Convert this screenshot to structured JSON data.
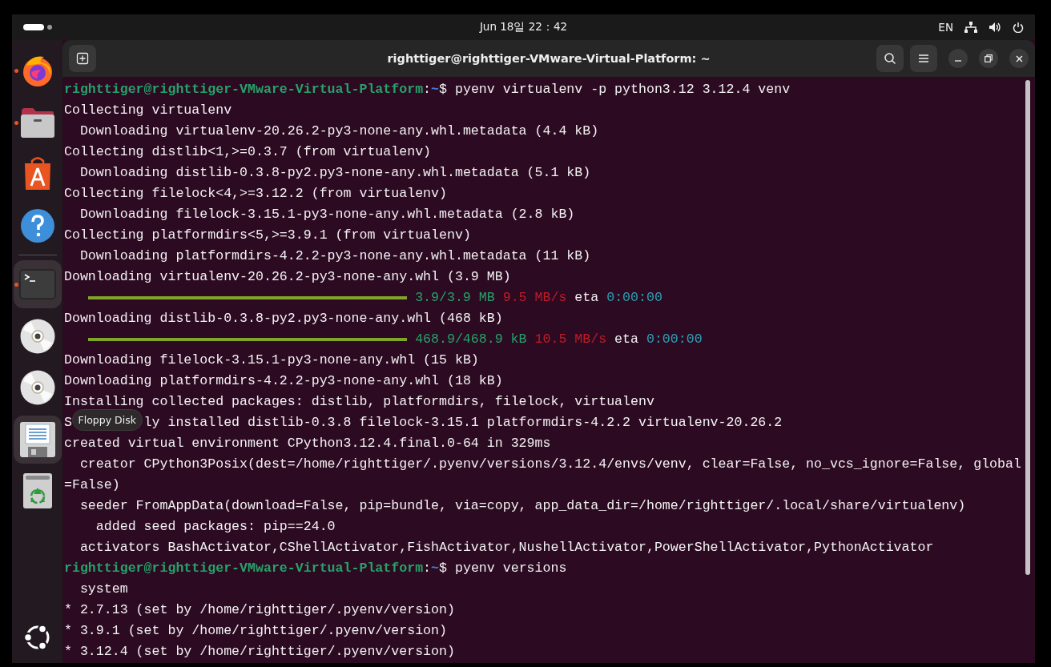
{
  "top_bar": {
    "clock": "Jun 18일 22：42",
    "input_language": "EN"
  },
  "dock": {
    "items": [
      {
        "kind": "firefox",
        "running": true,
        "highlighted": false
      },
      {
        "kind": "files",
        "running": true,
        "highlighted": false
      },
      {
        "kind": "app-center",
        "running": false,
        "highlighted": false
      },
      {
        "kind": "help",
        "running": false,
        "highlighted": false
      },
      {
        "kind": "separator"
      },
      {
        "kind": "terminal",
        "running": true,
        "highlighted": true
      },
      {
        "kind": "disc",
        "running": false,
        "highlighted": false
      },
      {
        "kind": "disc",
        "running": false,
        "highlighted": false
      },
      {
        "kind": "floppy",
        "running": false,
        "highlighted": true,
        "tooltip": "Floppy Disk"
      },
      {
        "kind": "trash",
        "running": false,
        "highlighted": false
      }
    ],
    "show_apps": true
  },
  "window": {
    "title": "righttiger@righttiger-VMware-Virtual-Platform: ~"
  },
  "terminal": {
    "lines": [
      {
        "kind": "prompt",
        "user": "righttiger@righttiger-VMware-Virtual-Platform",
        "sep": ":",
        "path": "~",
        "command": "$ pyenv virtualenv -p python3.12 3.12.4 venv"
      },
      {
        "kind": "output",
        "text": "Collecting virtualenv"
      },
      {
        "kind": "output",
        "text": "  Downloading virtualenv-20.26.2-py3-none-any.whl.metadata (4.4 kB)"
      },
      {
        "kind": "output",
        "text": "Collecting distlib<1,>=0.3.7 (from virtualenv)"
      },
      {
        "kind": "output",
        "text": "  Downloading distlib-0.3.8-py2.py3-none-any.whl.metadata (5.1 kB)"
      },
      {
        "kind": "output",
        "text": "Collecting filelock<4,>=3.12.2 (from virtualenv)"
      },
      {
        "kind": "output",
        "text": "  Downloading filelock-3.15.1-py3-none-any.whl.metadata (2.8 kB)"
      },
      {
        "kind": "output",
        "text": "Collecting platformdirs<5,>=3.9.1 (from virtualenv)"
      },
      {
        "kind": "output",
        "text": "  Downloading platformdirs-4.2.2-py3-none-any.whl.metadata (11 kB)"
      },
      {
        "kind": "output",
        "text": "Downloading virtualenv-20.26.2-py3-none-any.whl (3.9 MB)"
      },
      {
        "kind": "progress",
        "level": 1,
        "amount": "3.9/3.9 MB",
        "speed": "9.5 MB/s",
        "eta_label": "eta",
        "eta": "0:00:00"
      },
      {
        "kind": "output",
        "text": "Downloading distlib-0.3.8-py2.py3-none-any.whl (468 kB)"
      },
      {
        "kind": "progress",
        "level": 1,
        "amount": "468.9/468.9 kB",
        "speed": "10.5 MB/s",
        "eta_label": "eta",
        "eta": "0:00:00"
      },
      {
        "kind": "output",
        "text": "Downloading filelock-3.15.1-py3-none-any.whl (15 kB)"
      },
      {
        "kind": "output",
        "text": "Downloading platformdirs-4.2.2-py3-none-any.whl (18 kB)"
      },
      {
        "kind": "output",
        "text": "Installing collected packages: distlib, platformdirs, filelock, virtualenv"
      },
      {
        "kind": "covered",
        "before": "S",
        "after": "ly installed distlib-0.3.8 filelock-3.15.1 platformdirs-4.2.2 virtualenv-20.26.2"
      },
      {
        "kind": "output",
        "text": "created virtual environment CPython3.12.4.final.0-64 in 329ms"
      },
      {
        "kind": "output",
        "text": "  creator CPython3Posix(dest=/home/righttiger/.pyenv/versions/3.12.4/envs/venv, clear=False, no_vcs_ignore=False, global"
      },
      {
        "kind": "output",
        "text": "=False)"
      },
      {
        "kind": "output",
        "text": "  seeder FromAppData(download=False, pip=bundle, via=copy, app_data_dir=/home/righttiger/.local/share/virtualenv)"
      },
      {
        "kind": "output",
        "text": "    added seed packages: pip==24.0"
      },
      {
        "kind": "output",
        "text": "  activators BashActivator,CShellActivator,FishActivator,NushellActivator,PowerShellActivator,PythonActivator"
      },
      {
        "kind": "prompt",
        "user": "righttiger@righttiger-VMware-Virtual-Platform",
        "sep": ":",
        "path": "~",
        "command": "$ pyenv versions"
      },
      {
        "kind": "output",
        "text": "  system"
      },
      {
        "kind": "output",
        "text": "* 2.7.13 (set by /home/righttiger/.pyenv/version)"
      },
      {
        "kind": "output",
        "text": "* 3.9.1 (set by /home/righttiger/.pyenv/version)"
      },
      {
        "kind": "output",
        "text": "* 3.12.4 (set by /home/righttiger/.pyenv/version)"
      }
    ]
  }
}
